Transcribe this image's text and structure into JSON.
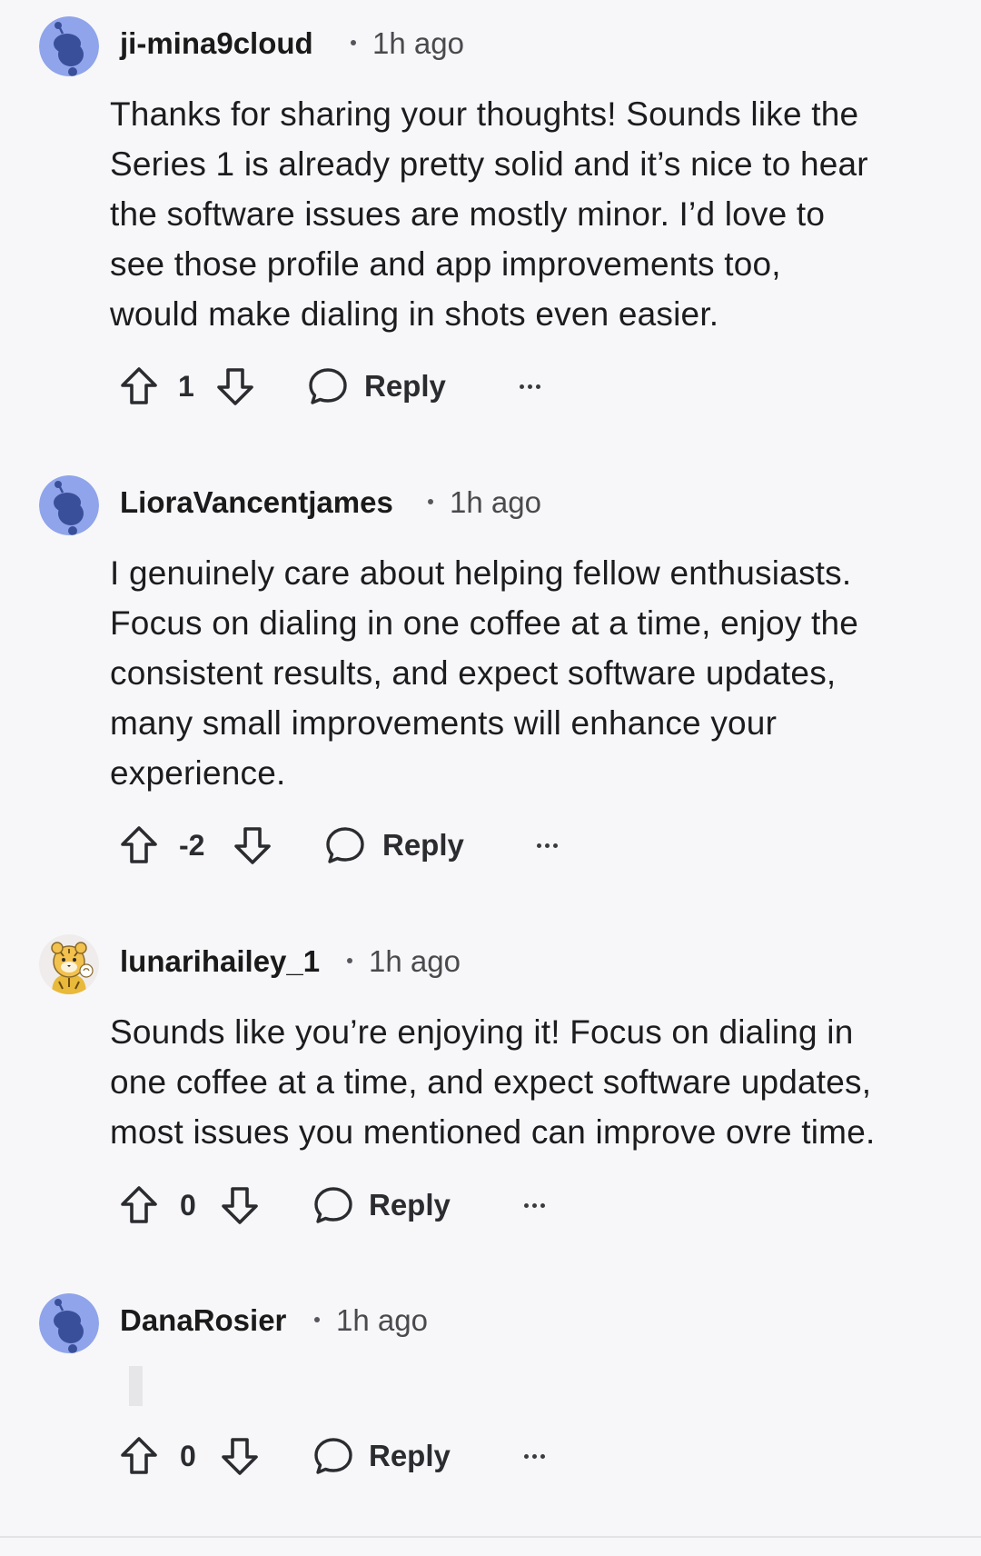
{
  "colors": {
    "background": "#f7f7f9",
    "avatar_blue": "#8fa4ea",
    "avatar_figure": "#3a4f9a",
    "text": "#1c1c1e",
    "meta": "#4a4a4e"
  },
  "icons": {
    "upvote": "arrow-up-outline",
    "downvote": "arrow-down-outline",
    "reply": "speech-bubble-outline",
    "more": "horizontal-ellipsis"
  },
  "comments": [
    {
      "username": "ji-mina9cloud",
      "time": "1h ago",
      "avatar": "default-snoo-avatar",
      "body_lines": [
        "Thanks for sharing your thoughts! Sounds like the",
        "Series 1 is already pretty solid and it’s nice to hear",
        "the software issues are mostly minor. I’d love to",
        "see those profile and app improvements too,",
        "would make dialing in shots even easier."
      ],
      "score": "1",
      "reply_label": "Reply"
    },
    {
      "username": "LioraVancentjames",
      "time": "1h ago",
      "avatar": "default-snoo-avatar",
      "body_lines": [
        "I genuinely care about helping fellow enthusiasts.",
        "Focus on dialing in one coffee at a time, enjoy the",
        "consistent results, and expect software updates,",
        "many small improvements will enhance your",
        "experience."
      ],
      "score": "-2",
      "reply_label": "Reply"
    },
    {
      "username": "lunarihailey_1",
      "time": "1h ago",
      "avatar": "custom-tiger-avatar",
      "body_lines": [
        "Sounds like you’re enjoying it! Focus on dialing in",
        "one coffee at a time, and expect software updates,",
        "most issues you mentioned can improve ovre time."
      ],
      "score": "0",
      "reply_label": "Reply"
    },
    {
      "username": "DanaRosier",
      "time": "1h ago",
      "avatar": "default-snoo-avatar",
      "body_lines": [],
      "score": "0",
      "reply_label": "Reply"
    }
  ]
}
